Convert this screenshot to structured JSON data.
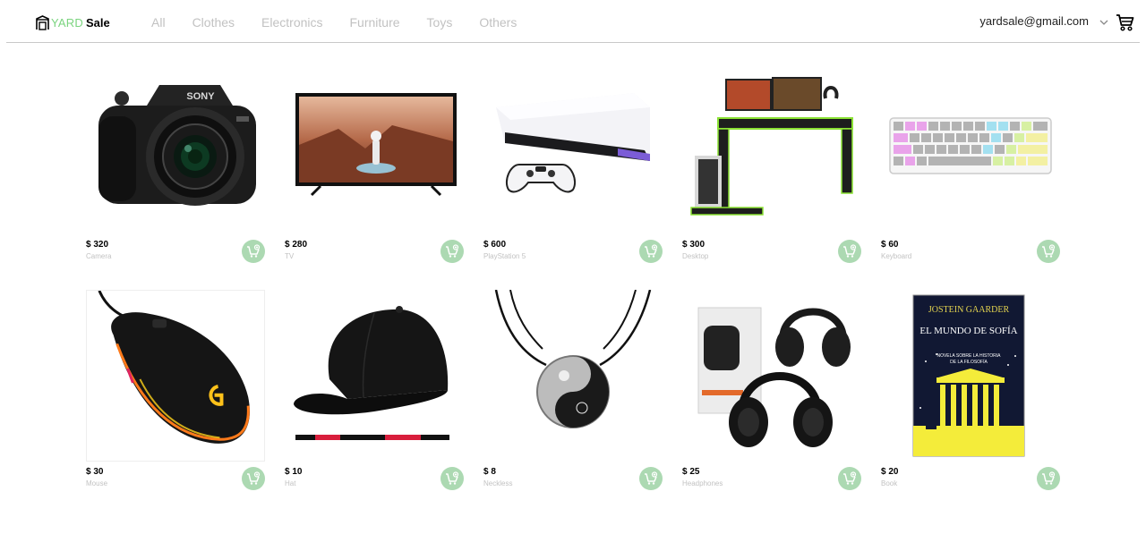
{
  "navbar": {
    "logo_prefix": "YARD",
    "logo_suffix": "Sale",
    "categories": [
      "All",
      "Clothes",
      "Electronics",
      "Furniture",
      "Toys",
      "Others"
    ],
    "user_email": "yardsale@gmail.com"
  },
  "colors": {
    "accent": "#7bd47f",
    "add_button": "#acd9b2",
    "muted_text": "#c2c2c2"
  },
  "products": [
    {
      "price": "$ 320",
      "name": "Camera",
      "icon": "camera-image"
    },
    {
      "price": "$ 280",
      "name": "TV",
      "icon": "tv-image"
    },
    {
      "price": "$ 600",
      "name": "PlayStation 5",
      "icon": "playstation-image"
    },
    {
      "price": "$ 300",
      "name": "Desktop",
      "icon": "desk-image"
    },
    {
      "price": "$ 60",
      "name": "Keyboard",
      "icon": "keyboard-image"
    },
    {
      "price": "$ 30",
      "name": "Mouse",
      "icon": "mouse-image"
    },
    {
      "price": "$ 10",
      "name": "Hat",
      "icon": "cap-image"
    },
    {
      "price": "$ 8",
      "name": "Neckless",
      "icon": "necklace-image"
    },
    {
      "price": "$ 25",
      "name": "Headphones",
      "icon": "headphones-image"
    },
    {
      "price": "$ 20",
      "name": "Book",
      "icon": "book-image"
    }
  ],
  "book_cover": {
    "author": "JOSTEIN GAARDER",
    "title": "EL MUNDO DE SOFÍA",
    "subtitle_line1": "NOVELA SOBRE LA HISTORIA",
    "subtitle_line2": "DE LA FILOSOFÍA"
  },
  "camera_brand": "SONY"
}
